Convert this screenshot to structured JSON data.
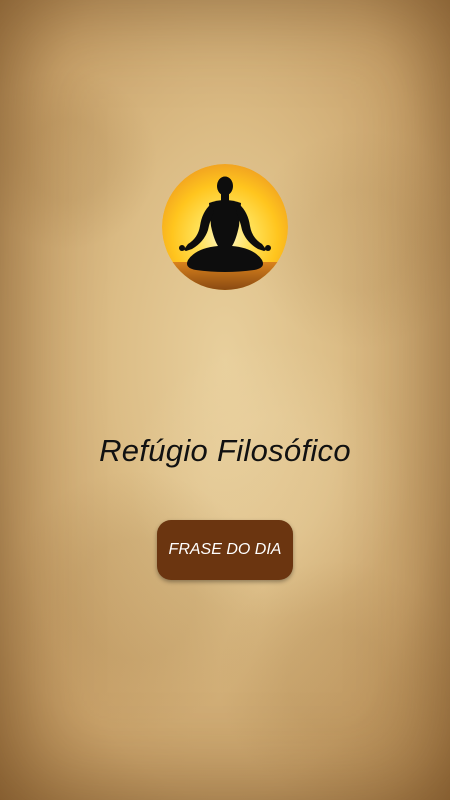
{
  "app": {
    "title": "Refúgio Filosófico"
  },
  "logo": {
    "icon": "meditation-silhouette-icon",
    "colors": {
      "sun_center": "#fff6c8",
      "sun_mid": "#ffd83a",
      "sun_edge": "#f0a020",
      "silhouette": "#0d0d0d"
    }
  },
  "actions": {
    "quote_of_day_label": "FRASE DO DIA"
  },
  "colors": {
    "button_bg": "#6b3510",
    "button_text": "#ffffff",
    "title_text": "#111111",
    "background": "#dcbd86"
  }
}
